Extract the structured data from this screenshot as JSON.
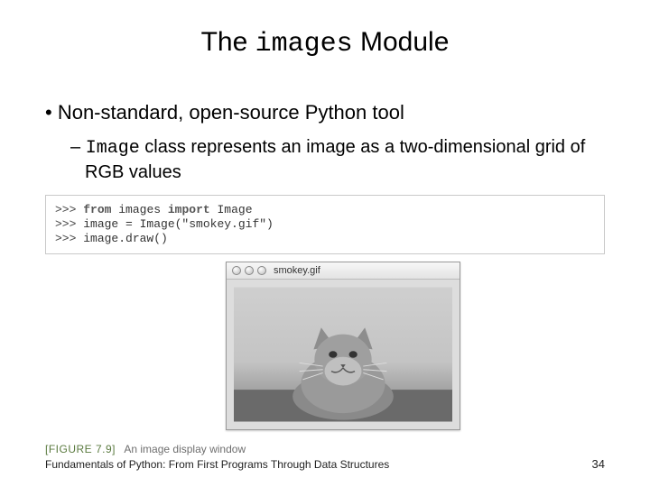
{
  "title": {
    "part1": "The ",
    "mono": "images",
    "part2": " Module"
  },
  "bullets": {
    "b1": "Non-standard, open-source Python tool",
    "sub1": {
      "mono": "Image",
      "text": " class represents an image as a two-dimensional grid of RGB values"
    }
  },
  "code": {
    "kw_from": "from",
    "kw_import": "import",
    "line1a": "images",
    "line1b": "Image",
    "line2": "image = Image(\"smokey.gif\")",
    "line3": "image.draw()"
  },
  "window": {
    "title": "smokey.gif"
  },
  "figure": {
    "tag": "[FIGURE 7.9]",
    "caption": "An image display window"
  },
  "footer": {
    "text": "Fundamentals of Python: From First Programs Through Data Structures",
    "page": "34"
  }
}
